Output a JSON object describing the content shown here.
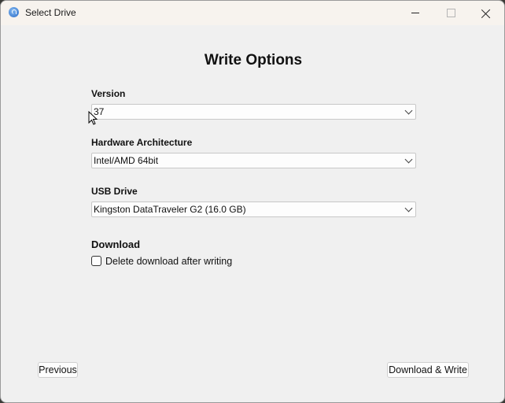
{
  "window": {
    "title": "Select Drive",
    "controls": {
      "minimize": "minimize-icon",
      "maximize": "maximize-icon",
      "close": "close-icon"
    }
  },
  "main": {
    "heading": "Write Options",
    "fields": [
      {
        "label": "Version",
        "value": "37"
      },
      {
        "label": "Hardware Architecture",
        "value": "Intel/AMD 64bit"
      },
      {
        "label": "USB Drive",
        "value": "Kingston DataTraveler G2 (16.0 GB)"
      }
    ],
    "download": {
      "section_label": "Download",
      "checkbox_label": "Delete download after writing",
      "checked": false
    }
  },
  "footer": {
    "previous_label": "Previous",
    "download_write_label": "Download & Write"
  }
}
